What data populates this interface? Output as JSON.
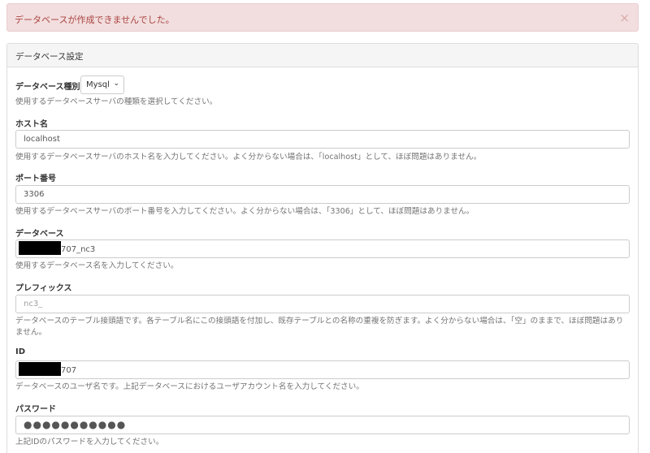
{
  "alert": {
    "message": "データベースが作成できませんでした。",
    "close_icon": "×"
  },
  "panel": {
    "title": "データベース設定"
  },
  "db_type": {
    "label": "データベース種別",
    "selected": "Mysql",
    "help": "使用するデータベースサーバの種類を選択してください。"
  },
  "host": {
    "label": "ホスト名",
    "value": "localhost",
    "help": "使用するデータベースサーバのホスト名を入力してください。よく分からない場合は、「localhost」として、ほぼ問題はありません。"
  },
  "port": {
    "label": "ポート番号",
    "value": "3306",
    "help": "使用するデータベースサーバのポート番号を入力してください。よく分からない場合は、「3306」として、ほぼ問題はありません。"
  },
  "database": {
    "label": "データベース",
    "value_visible": "707_nc3",
    "help": "使用するデータベース名を入力してください。"
  },
  "prefix": {
    "label": "プレフィックス",
    "placeholder": "nc3_",
    "help": "データベースのテーブル接頭語です。各テーブル名にこの接頭語を付加し、既存テーブルとの名称の重複を防ぎます。よく分からない場合は、「空」のままで、ほぼ問題はありません。"
  },
  "user_id": {
    "label": "ID",
    "value_visible": "707",
    "help": "データベースのユーザ名です。上記データベースにおけるユーザアカウント名を入力してください。"
  },
  "password": {
    "label": "パスワード",
    "masked": "●●●●●●●●●●●",
    "help": "上記IDのパスワードを入力してください。"
  }
}
